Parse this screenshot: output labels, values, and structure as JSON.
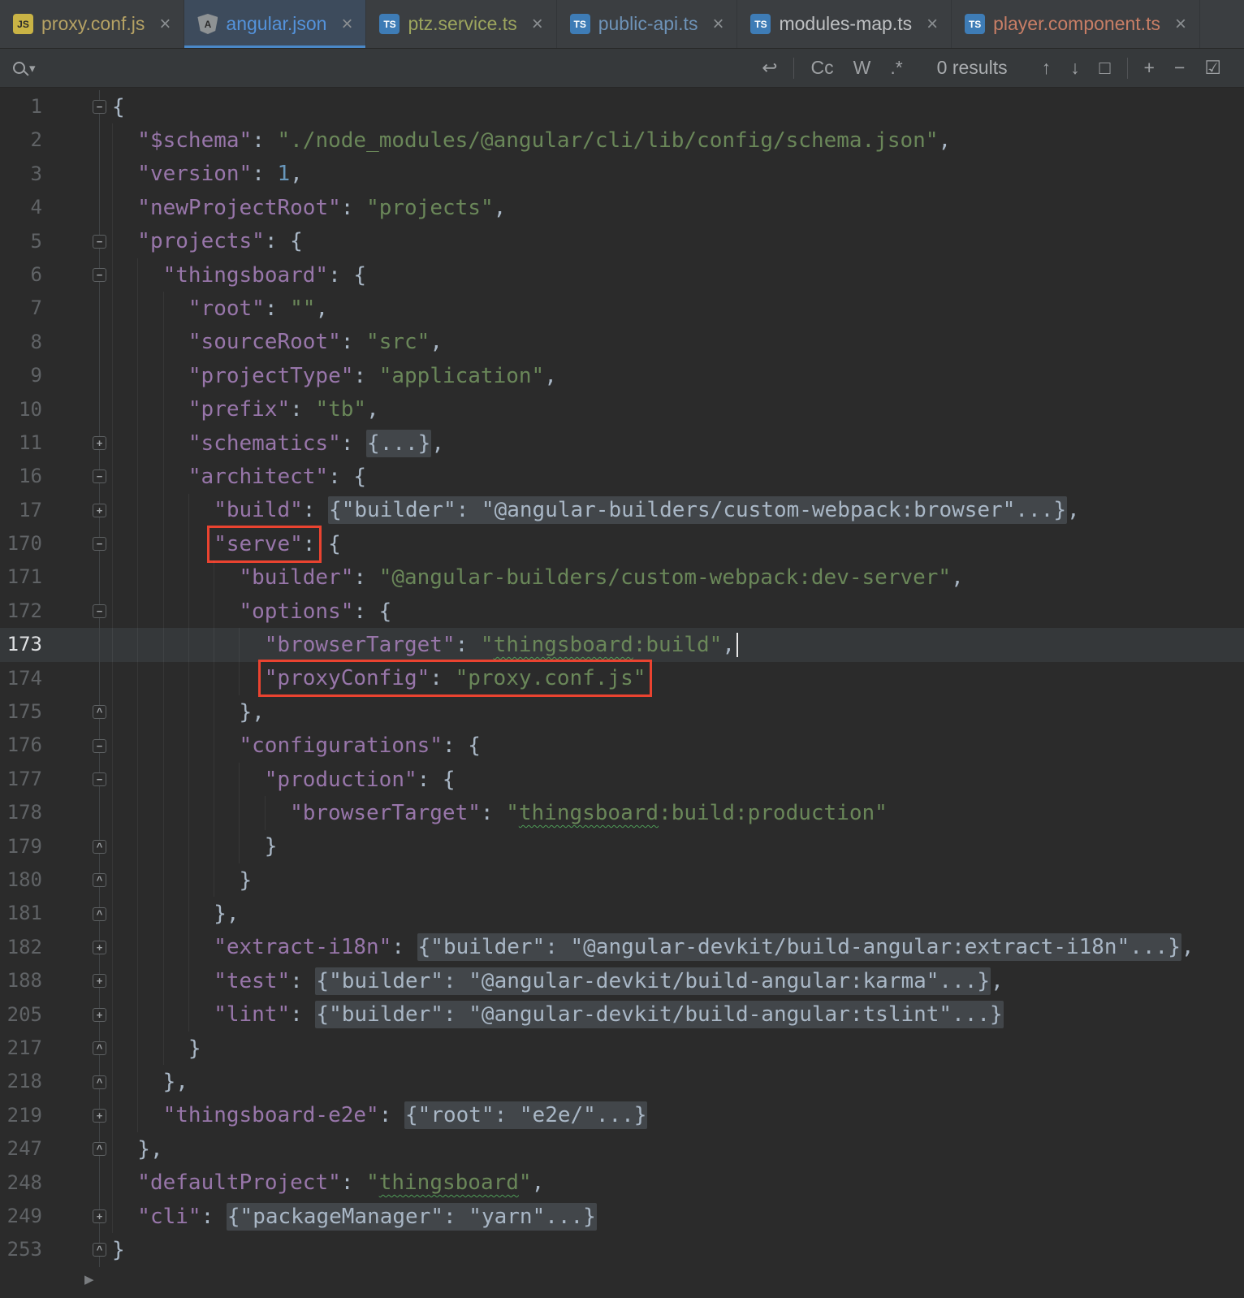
{
  "palette": {
    "bg_editor": "#2B2B2B",
    "bg_tabbar": "#3B3E41",
    "bg_findbar": "#36393B",
    "tab_active_bg": "#3D4B5C",
    "accent": "#4A88C7",
    "text": "#A9B7C6",
    "json_key": "#9876AA",
    "json_string": "#6A8759",
    "json_number": "#6897BB",
    "fold_bg": "#42464A",
    "line_number": "#606366",
    "current_line": "#35383A",
    "annotation_red": "#EA4330",
    "squiggle": "#4E9B57"
  },
  "icons": {
    "close": "×",
    "dropdown": "▾",
    "newline": "↩",
    "prev": "↑",
    "next": "↓",
    "find_all": "□",
    "add_sel": "+",
    "remove_sel": "−",
    "select_all": "☑",
    "bottom_arrow": "▶"
  },
  "tabs": [
    {
      "label": "proxy.conf.js",
      "color": "#B6A264",
      "icon_name": "javascript-file-icon",
      "icon_class": "js",
      "icon_glyph": "JS",
      "active": false
    },
    {
      "label": "angular.json",
      "color": "#5493DC",
      "icon_name": "angular-json-icon",
      "icon_class": "ng",
      "icon_glyph": "A",
      "active": true
    },
    {
      "label": "ptz.service.ts",
      "color": "#9CA55E",
      "icon_name": "typescript-file-icon",
      "icon_class": "ts",
      "icon_glyph": "TS",
      "active": false
    },
    {
      "label": "public-api.ts",
      "color": "#6E93B8",
      "icon_name": "typescript-file-icon",
      "icon_class": "ts",
      "icon_glyph": "TS",
      "active": false
    },
    {
      "label": "modules-map.ts",
      "color": "#BFC1C3",
      "icon_name": "typescript-file-icon",
      "icon_class": "ts",
      "icon_glyph": "TS",
      "active": false
    },
    {
      "label": "player.component.ts",
      "color": "#C87E66",
      "icon_name": "typescript-file-icon",
      "icon_class": "ts",
      "icon_glyph": "TS",
      "active": false
    }
  ],
  "find_bar": {
    "query": "",
    "match_case": "Cc",
    "words": "W",
    "regex": ".*",
    "results": "0 results"
  },
  "editor": {
    "lines": [
      {
        "no": "1",
        "ind": 0,
        "fold": "open",
        "tokens": [
          {
            "c": "p",
            "x": "{"
          }
        ]
      },
      {
        "no": "2",
        "ind": 1,
        "tokens": [
          {
            "c": "k",
            "x": "\"$schema\""
          },
          {
            "c": "p",
            "x": ": "
          },
          {
            "c": "s",
            "x": "\"./node_modules/@angular/cli/lib/config/schema.json\""
          },
          {
            "c": "p",
            "x": ","
          }
        ]
      },
      {
        "no": "3",
        "ind": 1,
        "tokens": [
          {
            "c": "k",
            "x": "\"version\""
          },
          {
            "c": "p",
            "x": ": "
          },
          {
            "c": "n",
            "x": "1"
          },
          {
            "c": "p",
            "x": ","
          }
        ]
      },
      {
        "no": "4",
        "ind": 1,
        "tokens": [
          {
            "c": "k",
            "x": "\"newProjectRoot\""
          },
          {
            "c": "p",
            "x": ": "
          },
          {
            "c": "s",
            "x": "\"projects\""
          },
          {
            "c": "p",
            "x": ","
          }
        ]
      },
      {
        "no": "5",
        "ind": 1,
        "fold": "open",
        "tokens": [
          {
            "c": "k",
            "x": "\"projects\""
          },
          {
            "c": "p",
            "x": ": {"
          }
        ]
      },
      {
        "no": "6",
        "ind": 2,
        "fold": "open",
        "tokens": [
          {
            "c": "k",
            "x": "\"thingsboard\""
          },
          {
            "c": "p",
            "x": ": {"
          }
        ]
      },
      {
        "no": "7",
        "ind": 3,
        "tokens": [
          {
            "c": "k",
            "x": "\"root\""
          },
          {
            "c": "p",
            "x": ": "
          },
          {
            "c": "s",
            "x": "\"\""
          },
          {
            "c": "p",
            "x": ","
          }
        ]
      },
      {
        "no": "8",
        "ind": 3,
        "tokens": [
          {
            "c": "k",
            "x": "\"sourceRoot\""
          },
          {
            "c": "p",
            "x": ": "
          },
          {
            "c": "s",
            "x": "\"src\""
          },
          {
            "c": "p",
            "x": ","
          }
        ]
      },
      {
        "no": "9",
        "ind": 3,
        "tokens": [
          {
            "c": "k",
            "x": "\"projectType\""
          },
          {
            "c": "p",
            "x": ": "
          },
          {
            "c": "s",
            "x": "\"application\""
          },
          {
            "c": "p",
            "x": ","
          }
        ]
      },
      {
        "no": "10",
        "ind": 3,
        "tokens": [
          {
            "c": "k",
            "x": "\"prefix\""
          },
          {
            "c": "p",
            "x": ": "
          },
          {
            "c": "s",
            "x": "\"tb\""
          },
          {
            "c": "p",
            "x": ","
          }
        ]
      },
      {
        "no": "11",
        "ind": 3,
        "fold": "closed",
        "tokens": [
          {
            "c": "k",
            "x": "\"schematics\""
          },
          {
            "c": "p",
            "x": ": "
          },
          {
            "c": "f",
            "x": "{...}"
          },
          {
            "c": "p",
            "x": ","
          }
        ]
      },
      {
        "no": "16",
        "ind": 3,
        "fold": "open",
        "tokens": [
          {
            "c": "k",
            "x": "\"architect\""
          },
          {
            "c": "p",
            "x": ": {"
          }
        ]
      },
      {
        "no": "17",
        "ind": 4,
        "fold": "closed",
        "tokens": [
          {
            "c": "k",
            "x": "\"build\""
          },
          {
            "c": "p",
            "x": ": "
          },
          {
            "c": "f",
            "x": "{\"builder\": \"@angular-builders/custom-webpack:browser\"...}"
          },
          {
            "c": "p",
            "x": ","
          }
        ]
      },
      {
        "no": "170",
        "ind": 4,
        "fold": "open",
        "tokens": [
          {
            "c": "box",
            "t": [
              {
                "c": "k",
                "x": "\"serve\""
              },
              {
                "c": "p",
                "x": ":"
              }
            ]
          },
          {
            "c": "p",
            "x": " {"
          }
        ]
      },
      {
        "no": "171",
        "ind": 5,
        "tokens": [
          {
            "c": "k",
            "x": "\"builder\""
          },
          {
            "c": "p",
            "x": ": "
          },
          {
            "c": "s",
            "x": "\"@angular-builders/custom-webpack:dev-server\""
          },
          {
            "c": "p",
            "x": ","
          }
        ]
      },
      {
        "no": "172",
        "ind": 5,
        "fold": "open",
        "tokens": [
          {
            "c": "k",
            "x": "\"options\""
          },
          {
            "c": "p",
            "x": ": {"
          }
        ]
      },
      {
        "no": "173",
        "ind": 6,
        "current": true,
        "tokens": [
          {
            "c": "k",
            "x": "\"browserTarget\""
          },
          {
            "c": "p",
            "x": ": "
          },
          {
            "c": "s",
            "x": "\""
          },
          {
            "c": "sq",
            "x": "thingsboard"
          },
          {
            "c": "s",
            "x": ":build\""
          },
          {
            "c": "p",
            "x": ","
          },
          {
            "c": "caret"
          }
        ]
      },
      {
        "no": "174",
        "ind": 6,
        "tokens": [
          {
            "c": "box",
            "t": [
              {
                "c": "k",
                "x": "\"proxyConfig\""
              },
              {
                "c": "p",
                "x": ": "
              },
              {
                "c": "s",
                "x": "\"proxy.conf.js\""
              }
            ]
          }
        ]
      },
      {
        "no": "175",
        "ind": 5,
        "fold": "end",
        "tokens": [
          {
            "c": "p",
            "x": "},"
          }
        ]
      },
      {
        "no": "176",
        "ind": 5,
        "fold": "open",
        "tokens": [
          {
            "c": "k",
            "x": "\"configurations\""
          },
          {
            "c": "p",
            "x": ": {"
          }
        ]
      },
      {
        "no": "177",
        "ind": 6,
        "fold": "open",
        "tokens": [
          {
            "c": "k",
            "x": "\"production\""
          },
          {
            "c": "p",
            "x": ": {"
          }
        ]
      },
      {
        "no": "178",
        "ind": 7,
        "tokens": [
          {
            "c": "k",
            "x": "\"browserTarget\""
          },
          {
            "c": "p",
            "x": ": "
          },
          {
            "c": "s",
            "x": "\""
          },
          {
            "c": "sq",
            "x": "thingsboard"
          },
          {
            "c": "s",
            "x": ":build:production\""
          }
        ]
      },
      {
        "no": "179",
        "ind": 6,
        "fold": "end",
        "tokens": [
          {
            "c": "p",
            "x": "}"
          }
        ]
      },
      {
        "no": "180",
        "ind": 5,
        "fold": "end",
        "tokens": [
          {
            "c": "p",
            "x": "}"
          }
        ]
      },
      {
        "no": "181",
        "ind": 4,
        "fold": "end",
        "tokens": [
          {
            "c": "p",
            "x": "},"
          }
        ]
      },
      {
        "no": "182",
        "ind": 4,
        "fold": "closed",
        "tokens": [
          {
            "c": "k",
            "x": "\"extract-i18n\""
          },
          {
            "c": "p",
            "x": ": "
          },
          {
            "c": "f",
            "x": "{\"builder\": \"@angular-devkit/build-angular:extract-i18n\"...}"
          },
          {
            "c": "p",
            "x": ","
          }
        ]
      },
      {
        "no": "188",
        "ind": 4,
        "fold": "closed",
        "tokens": [
          {
            "c": "k",
            "x": "\"test\""
          },
          {
            "c": "p",
            "x": ": "
          },
          {
            "c": "f",
            "x": "{\"builder\": \"@angular-devkit/build-angular:karma\"...}"
          },
          {
            "c": "p",
            "x": ","
          }
        ]
      },
      {
        "no": "205",
        "ind": 4,
        "fold": "closed",
        "tokens": [
          {
            "c": "k",
            "x": "\"lint\""
          },
          {
            "c": "p",
            "x": ": "
          },
          {
            "c": "f",
            "x": "{\"builder\": \"@angular-devkit/build-angular:tslint\"...}"
          }
        ]
      },
      {
        "no": "217",
        "ind": 3,
        "fold": "end",
        "tokens": [
          {
            "c": "p",
            "x": "}"
          }
        ]
      },
      {
        "no": "218",
        "ind": 2,
        "fold": "end",
        "tokens": [
          {
            "c": "p",
            "x": "},"
          }
        ]
      },
      {
        "no": "219",
        "ind": 2,
        "fold": "closed",
        "tokens": [
          {
            "c": "k",
            "x": "\"thingsboard-e2e\""
          },
          {
            "c": "p",
            "x": ": "
          },
          {
            "c": "f",
            "x": "{\"root\": \"e2e/\"...}"
          }
        ]
      },
      {
        "no": "247",
        "ind": 1,
        "fold": "end",
        "tokens": [
          {
            "c": "p",
            "x": "},"
          }
        ]
      },
      {
        "no": "248",
        "ind": 1,
        "tokens": [
          {
            "c": "k",
            "x": "\"defaultProject\""
          },
          {
            "c": "p",
            "x": ": "
          },
          {
            "c": "s",
            "x": "\""
          },
          {
            "c": "sq",
            "x": "thingsboard"
          },
          {
            "c": "s",
            "x": "\""
          },
          {
            "c": "p",
            "x": ","
          }
        ]
      },
      {
        "no": "249",
        "ind": 1,
        "fold": "closed",
        "tokens": [
          {
            "c": "k",
            "x": "\"cli\""
          },
          {
            "c": "p",
            "x": ": "
          },
          {
            "c": "f",
            "x": "{\"packageManager\": \"yarn\"...}"
          }
        ]
      },
      {
        "no": "253",
        "ind": 0,
        "fold": "end",
        "tokens": [
          {
            "c": "p",
            "x": "}"
          }
        ]
      }
    ]
  }
}
